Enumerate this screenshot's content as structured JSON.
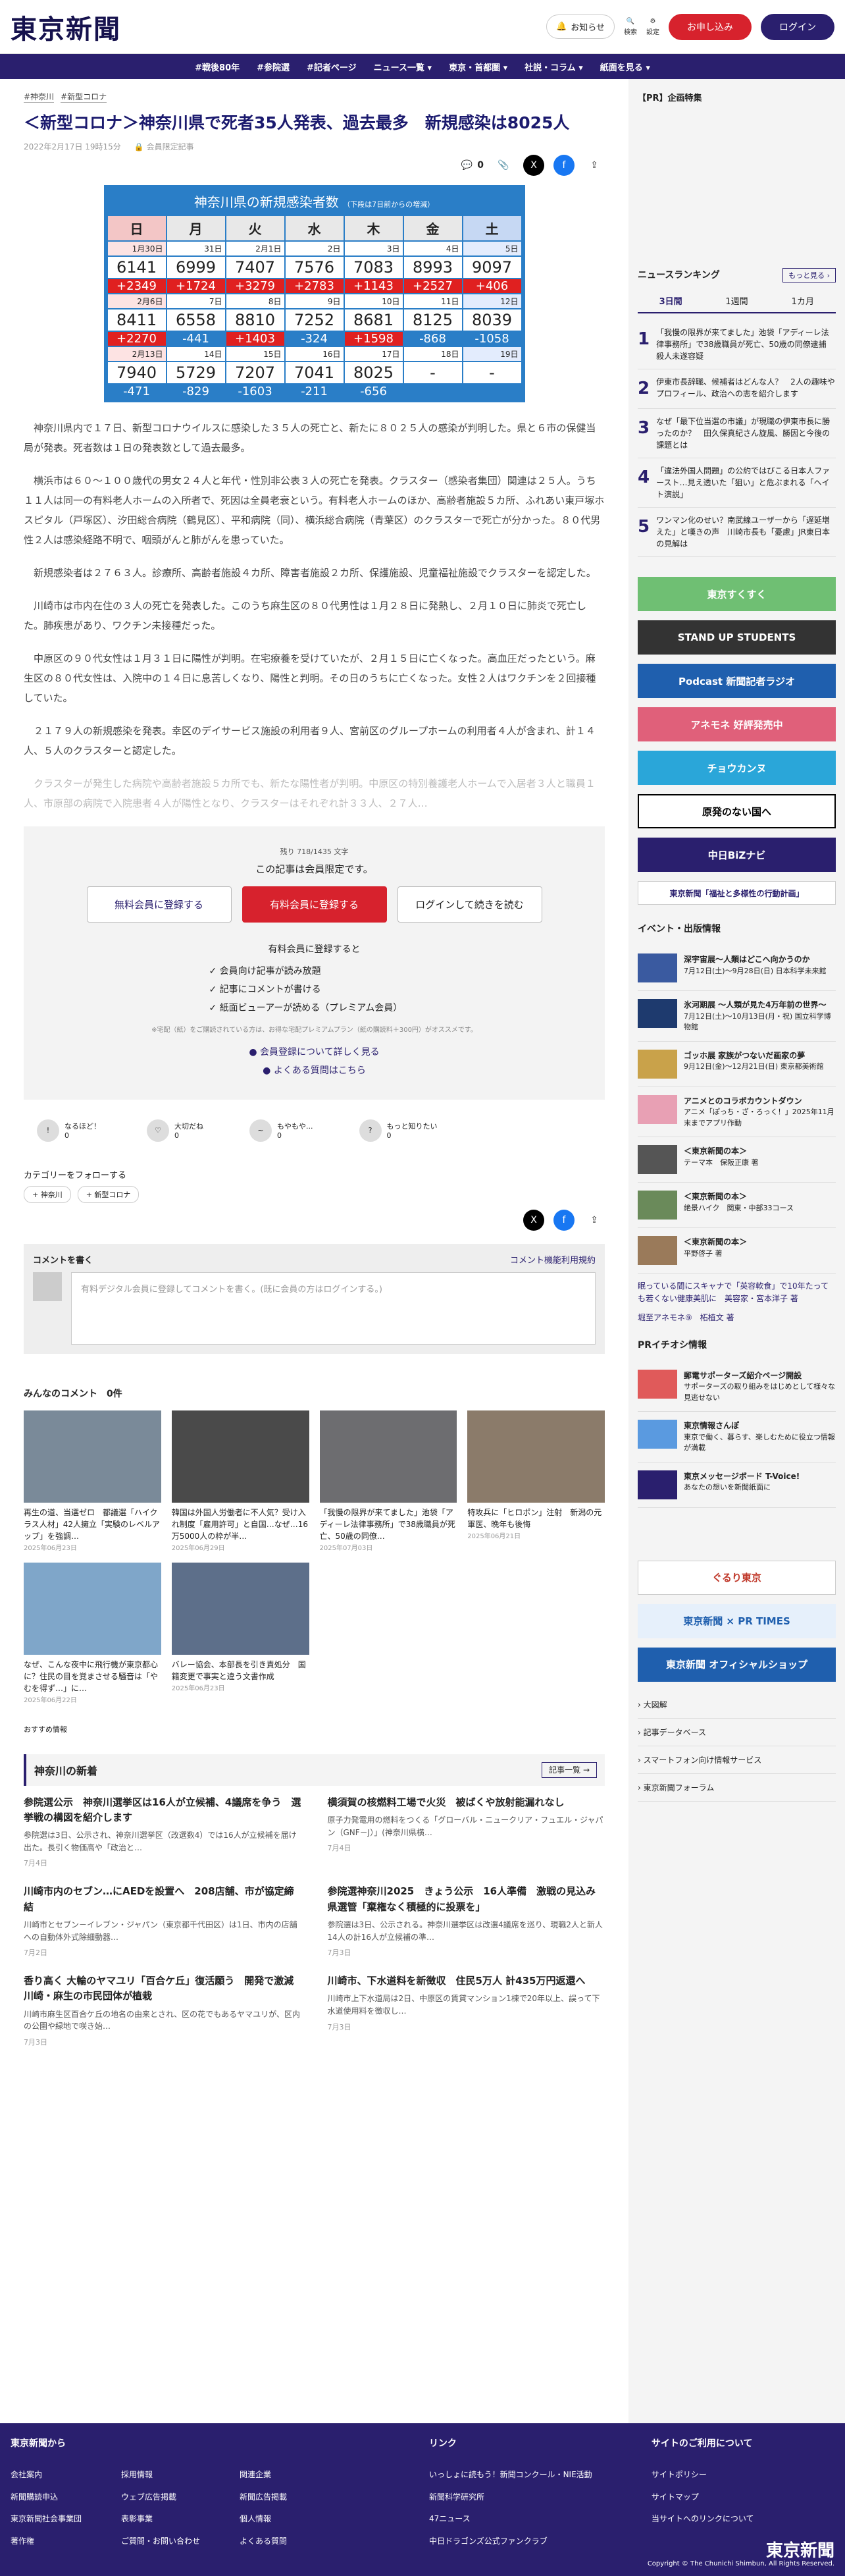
{
  "brand": "東京新聞",
  "header": {
    "notify": "お知らせ",
    "search": "検索",
    "settings": "設定",
    "register": "お申し込み",
    "login": "ログイン"
  },
  "nav": [
    "#戦後80年",
    "#参院選",
    "#記者ページ",
    "ニュース一覧 ▾",
    "東京・首都圏 ▾",
    "社説・コラム ▾",
    "紙面を見る ▾"
  ],
  "tags": [
    "#神奈川",
    "#新型コロナ"
  ],
  "article": {
    "title": "＜新型コロナ＞神奈川県で死者35人発表、過去最多　新規感染は8025人",
    "date": "2022年2月17日 19時15分",
    "members": "会員限定記事",
    "comments": "0",
    "paragraphs": [
      "神奈川県内で１７日、新型コロナウイルスに感染した３５人の死亡と、新たに８０２５人の感染が判明した。県と６市の保健当局が発表。死者数は１日の発表数として過去最多。",
      "横浜市は６０～１００歳代の男女２４人と年代・性別非公表３人の死亡を発表。クラスター（感染者集団）関連は２５人。うち１１人は同一の有料老人ホームの入所者で、死因は全員老衰という。有料老人ホームのほか、高齢者施設５カ所、ふれあい東戸塚ホスピタル（戸塚区）、汐田総合病院（鶴見区）、平和病院（同）、横浜総合病院（青葉区）のクラスターで死亡が分かった。８０代男性２人は感染経路不明で、咽頭がんと肺がんを患っていた。",
      "新規感染者は２７６３人。診療所、高齢者施設４カ所、障害者施設２カ所、保護施設、児童福祉施設でクラスターを認定した。",
      "川崎市は市内在住の３人の死亡を発表した。このうち麻生区の８０代男性は１月２８日に発熱し、２月１０日に肺炎で死亡した。肺疾患があり、ワクチン未接種だった。",
      "中原区の９０代女性は１月３１日に陽性が判明。在宅療養を受けていたが、２月１５日に亡くなった。高血圧だったという。麻生区の８０代女性は、入院中の１４日に息苦しくなり、陽性と判明。その日のうちに亡くなった。女性２人はワクチンを２回接種していた。",
      "２１７９人の新規感染を発表。幸区のデイサービス施設の利用者９人、宮前区のグループホームの利用者４人が含まれ、計１４人、５人のクラスターと認定した。",
      "クラスターが発生した病院や高齢者施設５カ所でも、新たな陽性者が判明。中原区の特別養護老人ホームで入居者３人と職員１人、市原部の病院で入院患者４人が陽性となり、クラスターはそれぞれ計３３人、２７人…"
    ]
  },
  "table": {
    "title": "神奈川県の新規感染者数",
    "note": "（下段は7日前からの増減）",
    "days": [
      "日",
      "月",
      "火",
      "水",
      "木",
      "金",
      "土"
    ],
    "weeks": [
      {
        "dates": [
          "1月30日",
          "31日",
          "2月1日",
          "2日",
          "3日",
          "4日",
          "5日"
        ],
        "cases": [
          "6141",
          "6999",
          "7407",
          "7576",
          "7083",
          "8993",
          "9097"
        ],
        "diff": [
          "+2349",
          "+1724",
          "+3279",
          "+2783",
          "+1143",
          "+2527",
          "+406"
        ]
      },
      {
        "dates": [
          "2月6日",
          "7日",
          "8日",
          "9日",
          "10日",
          "11日",
          "12日"
        ],
        "cases": [
          "8411",
          "6558",
          "8810",
          "7252",
          "8681",
          "8125",
          "8039"
        ],
        "diff": [
          "+2270",
          "-441",
          "+1403",
          "-324",
          "+1598",
          "-868",
          "-1058"
        ]
      },
      {
        "dates": [
          "2月13日",
          "14日",
          "15日",
          "16日",
          "17日",
          "18日",
          "19日"
        ],
        "cases": [
          "7940",
          "5729",
          "7207",
          "7041",
          "8025",
          "-",
          "-"
        ],
        "diff": [
          "-471",
          "-829",
          "-1603",
          "-211",
          "-656",
          "",
          ""
        ]
      }
    ]
  },
  "paywall": {
    "count": "残り 718/1435 文字",
    "title": "この記事は会員限定です。",
    "free": "無料会員に登録する",
    "paid": "有料会員に登録する",
    "login": "ログインして続きを読む",
    "benefits_title": "有料会員に登録すると",
    "benefits": [
      "✓ 会員向け記事が読み放題",
      "✓ 記事にコメントが書ける",
      "✓ 紙面ビューアーが読める（プレミアム会員）"
    ],
    "note": "※宅配（紙）をご購読されている方は、お得な宅配プレミアムプラン（紙の購読料＋300円）がオススメです。",
    "link1": "● 会員登録について詳しく見る",
    "link2": "● よくある質問はこちら"
  },
  "reactions": [
    {
      "l": "なるほど！",
      "n": "0"
    },
    {
      "l": "大切だね",
      "n": "0"
    },
    {
      "l": "もやもや...",
      "n": "0"
    },
    {
      "l": "もっと知りたい",
      "n": "0"
    }
  ],
  "follow": "カテゴリーをフォローする",
  "follow_tags": [
    "+ 神奈川",
    "+ 新型コロナ"
  ],
  "comment": {
    "title": "コメントを書く",
    "rules": "コメント機能利用規約",
    "placeholder": "有料デジタル会員に登録してコメントを書く。(既に会員の方はログインする。)"
  },
  "all_comments": "みんなのコメント　0件",
  "related": [
    {
      "t": "再生の道、当選ゼロ　都議選「ハイクラス人材」42人擁立「実験のレベルアップ」を強調…",
      "d": "2025年06月23日"
    },
    {
      "t": "韓国は外国人労働者に不人気？受け入れ制度「雇用許可」と自国…なぜ…16万5000人の枠が半…",
      "d": "2025年06月29日"
    },
    {
      "t": "「我慢の限界が来てました」池袋「アディーレ法律事務所」で38歳職員が死亡、50歳の同僚…",
      "d": "2025年07月03日"
    },
    {
      "t": "特攻兵に「ヒロポン」注射　新潟の元軍医、晩年も後悔",
      "d": "2025年06月21日"
    },
    {
      "t": "なぜ、こんな夜中に飛行機が東京都心に？住民の目を覚まさせる騒音は「やむを得ず…」に…",
      "d": "2025年06月22日"
    },
    {
      "t": "バレー協会、本部長を引き責処分　国籍変更で事実と違う文書作成",
      "d": "2025年06月23日"
    }
  ],
  "recommend": "おすすめ情報",
  "local": {
    "title": "神奈川の新着",
    "more": "記事一覧 →",
    "items": [
      {
        "t": "参院選公示　神奈川選挙区は16人が立候補、4議席を争う　選挙戦の構図を紹介します",
        "s": "参院選は3日、公示され、神奈川選挙区（改選数4）では16人が立候補を届け出た。長引く物価高や「政治と…",
        "d": "7月4日"
      },
      {
        "t": "横須賀の核燃料工場で火災　被ばくや放射能漏れなし",
        "s": "原子力発電用の燃料をつくる「グローバル・ニュークリア・フュエル・ジャパン（GNF－J）」(神奈川県横…",
        "d": "7月4日"
      },
      {
        "t": "川崎市内のセブン…にAEDを設置へ　208店舗、市が協定締結",
        "s": "川崎市とセブン－イレブン・ジャパン（東京都千代田区）は1日、市内の店舗への自動体外式除細動器…",
        "d": "7月2日"
      },
      {
        "t": "参院選神奈川2025　きょう公示　16人準備　激戦の見込み　県選管「棄権なく積極的に投票を」",
        "s": "参院選は3日、公示される。神奈川選挙区は改選4議席を巡り、現職2人と新人14人の計16人が立候補の準…",
        "d": "7月3日"
      },
      {
        "t": "香り高く 大輪のヤマユリ「百合ケ丘」復活願う　開発で激減　川崎・麻生の市民団体が植栽",
        "s": "川崎市麻生区百合ケ丘の地名の由来とされ、区の花でもあるヤマユリが、区内の公園や緑地で咲き始…",
        "d": "7月3日"
      },
      {
        "t": "川崎市、下水道料を新徴収　住民5万人 計435万円返還へ",
        "s": "川崎市上下水道局は2日、中原区の賃貸マンション1棟で20年以上、誤って下水道使用料を徴収し…",
        "d": "7月3日"
      }
    ]
  },
  "sidebar": {
    "ad_label": "【PR】企画特集",
    "ranking_title": "ニュースランキング",
    "ranking_more": "もっと見る ›",
    "ranking_tabs": [
      "3日間",
      "1週間",
      "1カ月"
    ],
    "ranking": [
      {
        "n": "1",
        "t": "「我慢の限界が来てました」池袋「アディーレ法律事務所」で38歳職員が死亡、50歳の同僚逮捕　殺人未遂容疑"
      },
      {
        "n": "2",
        "t": "伊東市長辞職、候補者はどんな人？　2人の趣味やプロフィール、政治への志を紹介します"
      },
      {
        "n": "3",
        "t": "なぜ「最下位当選の市議」が現職の伊東市長に勝ったのか？　田久保真紀さん旋風、勝因と今後の課題とは"
      },
      {
        "n": "4",
        "t": "「違法外国人問題」の公約ではびこる日本人ファースト…見え透いた「狙い」と危ぶまれる「ヘイト演説」"
      },
      {
        "n": "5",
        "t": "ワンマン化のせい？南武線ユーザーから「遅延増えた」と嘆きの声　川崎市長も「憂慮」JR東日本の見解は"
      }
    ],
    "banners": [
      "東京すくすく",
      "STAND UP STUDENTS",
      "Podcast 新聞記者ラジオ",
      "アネモネ 好評発売中",
      "チョウカンヌ",
      "原発のない国へ",
      "中日BiZナビ",
      "東京新聞「福祉と多様性の行動計画」"
    ],
    "events_title": "イベント・出版情報",
    "events": [
      {
        "t": "深宇宙展〜人類はどこへ向かうのか",
        "s": "7月12日(土)〜9月28日(日) 日本科学未来館"
      },
      {
        "t": "氷河期展 〜人類が見た4万年前の世界〜",
        "s": "7月12日(土)〜10月13日(月・祝) 国立科学博物館"
      },
      {
        "t": "ゴッホ展 家族がつないだ画家の夢",
        "s": "9月12日(金)〜12月21日(日) 東京都美術館"
      },
      {
        "t": "アニメとのコラボカウントダウン",
        "s": "アニメ「ぽっち・ざ・ろっく！」2025年11月末までアプリ作動"
      },
      {
        "t": "＜東京新聞の本＞",
        "s": "テーマ本　保阪正康 著"
      },
      {
        "t": "＜東京新聞の本＞",
        "s": "絶景ハイク　関東・中部33コース"
      },
      {
        "t": "＜東京新聞の本＞",
        "s": "平野啓子 著"
      }
    ],
    "sponsor_links": [
      "眠っている間にスキャナで「英容軟食」で10年たっても若くない健康美肌に　美容家・宮本洋子 著",
      "堀至アネモネ⑨　柘植文 著"
    ],
    "pr_title": "PRイチオシ情報",
    "pr": [
      {
        "t": "郵電サポーターズ紹介ページ開設",
        "s": "サポーターズの取り組みをはじめとして様々な見逃せない"
      },
      {
        "t": "東京情報さんぽ",
        "s": "東京で働く、暮らす、楽しむために役立つ情報が満載"
      },
      {
        "t": "東京メッセージボード T-Voice!",
        "s": "あなたの想いを新聞紙面に"
      }
    ],
    "bottom_banners": [
      "ぐるり東京",
      "東京新聞 × PR TIMES",
      "東京新聞 オフィシャルショップ"
    ],
    "links": [
      "› 大図解",
      "› 記事データベース",
      "› スマートフォン向け情報サービス",
      "› 東京新聞フォーラム"
    ]
  },
  "footer": {
    "c1_title": "東京新聞から",
    "c1": [
      "会社案内",
      "新聞購読申込",
      "東京新聞社会事業団",
      "著作権"
    ],
    "c1b": [
      "採用情報",
      "ウェブ広告掲載",
      "表彰事業",
      "ご質問・お問い合わせ"
    ],
    "c1c": [
      "関連企業",
      "新聞広告掲載",
      "個人情報",
      "よくある質問"
    ],
    "c2_title": "リンク",
    "c2": [
      "いっしょに読もう！新聞コンクール・NIE活動",
      "新聞科学研究所",
      "47ニュース",
      "中日ドラゴンズ公式ファンクラブ"
    ],
    "c3_title": "サイトのご利用について",
    "c3": [
      "サイトポリシー",
      "サイトマップ",
      "当サイトへのリンクについて"
    ],
    "copy": "Copyright © The Chunichi Shimbun, All Rights Reserved."
  }
}
